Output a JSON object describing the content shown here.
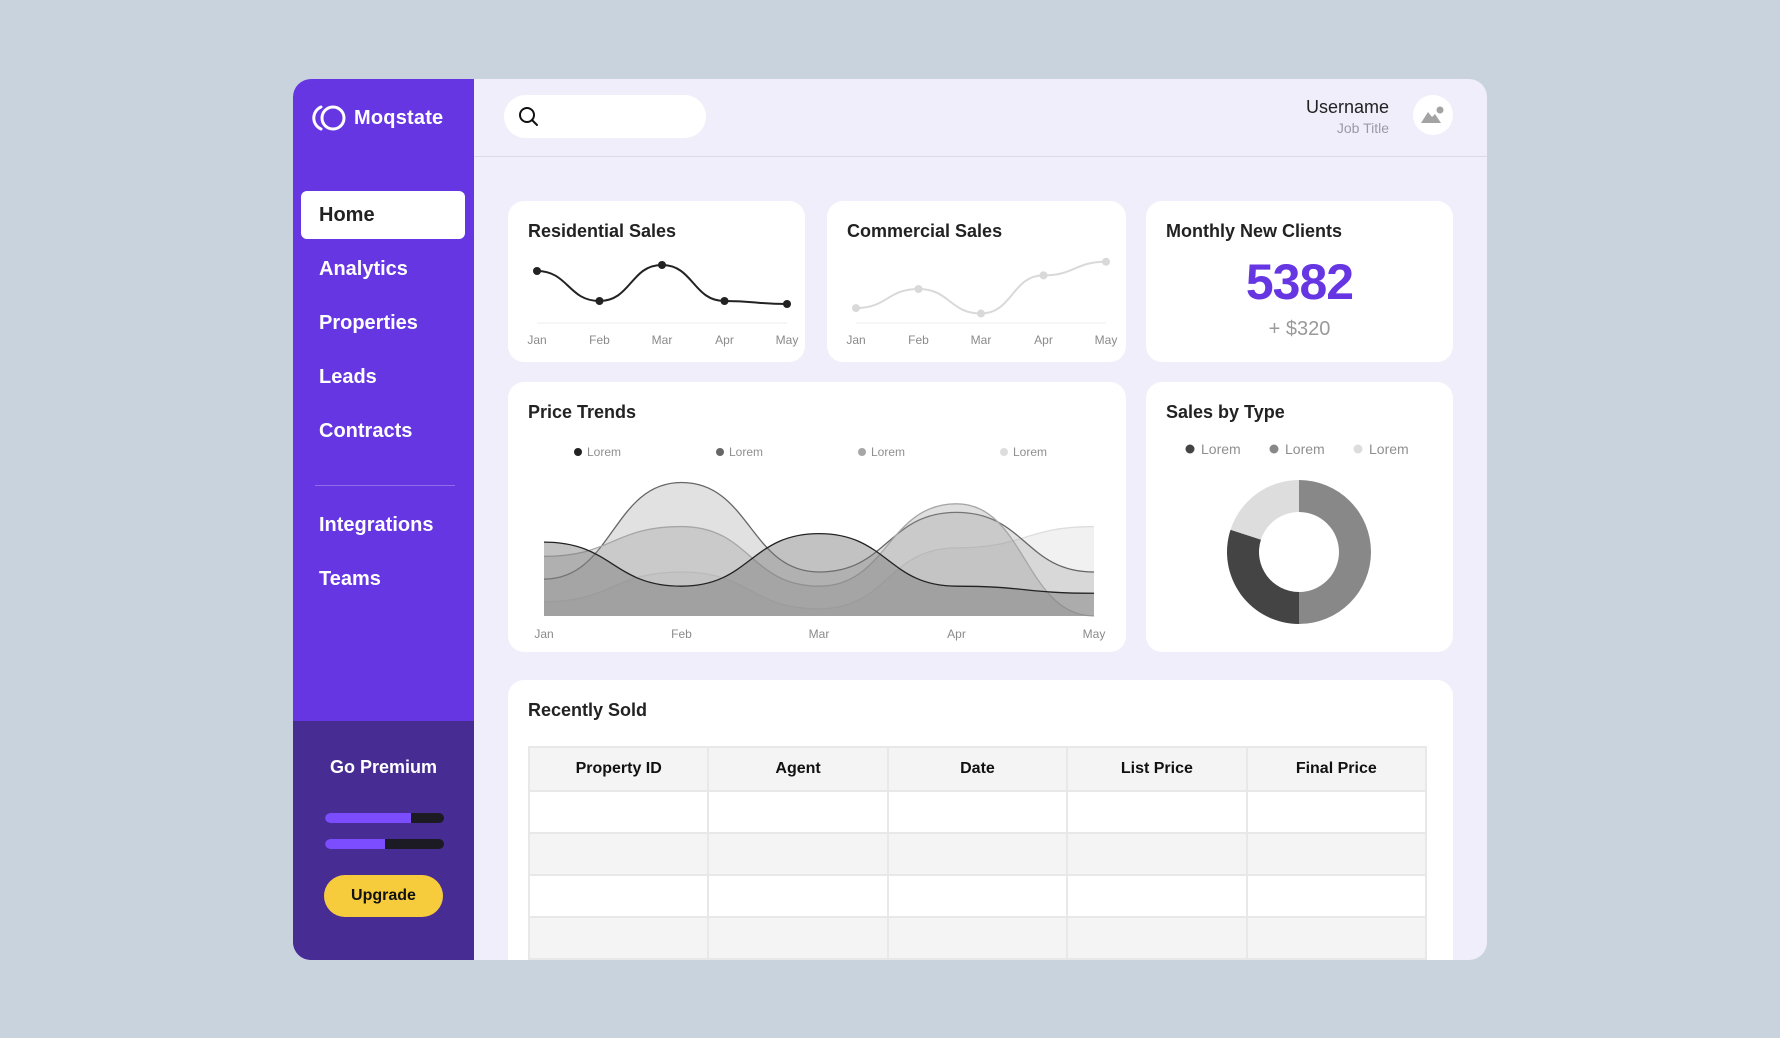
{
  "app": {
    "name": "Moqstate",
    "brand_color": "#6536e2",
    "sidebar_dark_color": "#472d93",
    "accent_yellow": "#f6cc3d"
  },
  "sidebar": {
    "primary_items": [
      {
        "label": "Home",
        "active": true
      },
      {
        "label": "Analytics",
        "active": false
      },
      {
        "label": "Properties",
        "active": false
      },
      {
        "label": "Leads",
        "active": false
      },
      {
        "label": "Contracts",
        "active": false
      }
    ],
    "secondary_items": [
      {
        "label": "Integrations",
        "active": false
      },
      {
        "label": "Teams",
        "active": false
      }
    ],
    "premium": {
      "title": "Go Premium",
      "progress": [
        0.72,
        0.5
      ],
      "button_label": "Upgrade"
    }
  },
  "header": {
    "search": {
      "value": "",
      "placeholder": "",
      "icon": "search-icon"
    },
    "user": {
      "name": "Username",
      "title": "Job Title",
      "avatar_icon": "image-placeholder-icon"
    }
  },
  "cards": {
    "residential": {
      "title": "Residential Sales"
    },
    "commercial": {
      "title": "Commercial Sales"
    },
    "clients": {
      "title": "Monthly New Clients",
      "value": "5382",
      "delta": "+ $320"
    },
    "price_trends": {
      "title": "Price Trends"
    },
    "sales_by_type": {
      "title": "Sales by Type"
    },
    "recently_sold": {
      "title": "Recently Sold",
      "columns": [
        "Property ID",
        "Agent",
        "Date",
        "List Price",
        "Final Price"
      ],
      "rows": [
        [
          "",
          "",
          "",
          "",
          ""
        ],
        [
          "",
          "",
          "",
          "",
          ""
        ],
        [
          "",
          "",
          "",
          "",
          ""
        ],
        [
          "",
          "",
          "",
          "",
          ""
        ]
      ]
    }
  },
  "chart_data": [
    {
      "id": "residential",
      "type": "line",
      "title": "Residential Sales",
      "categories": [
        "Jan",
        "Feb",
        "Mar",
        "Apr",
        "May"
      ],
      "values": [
        80,
        30,
        90,
        30,
        25
      ],
      "ylim": [
        0,
        100
      ],
      "color": "#222222",
      "markers": true
    },
    {
      "id": "commercial",
      "type": "line",
      "title": "Commercial Sales",
      "categories": [
        "Jan",
        "Feb",
        "Mar",
        "Apr",
        "May"
      ],
      "values": [
        20,
        55,
        10,
        80,
        105
      ],
      "ylim": [
        0,
        110
      ],
      "color": "#d9d9d9",
      "markers": true
    },
    {
      "id": "price_trends",
      "type": "area",
      "title": "Price Trends",
      "categories": [
        "Jan",
        "Feb",
        "Mar",
        "Apr",
        "May"
      ],
      "ylim": [
        0,
        100
      ],
      "legend_position": "top",
      "series": [
        {
          "name": "Lorem",
          "values": [
            52,
            21,
            58,
            21,
            16
          ],
          "color": "#222222"
        },
        {
          "name": "Lorem",
          "values": [
            26,
            94,
            31,
            73,
            31
          ],
          "color": "#666666"
        },
        {
          "name": "Lorem",
          "values": [
            42,
            63,
            21,
            79,
            0
          ],
          "color": "#a6a6a6"
        },
        {
          "name": "Lorem",
          "values": [
            10,
            31,
            5,
            48,
            63
          ],
          "color": "#dddddd"
        }
      ]
    },
    {
      "id": "sales_by_type",
      "type": "pie",
      "donut": true,
      "title": "Sales by Type",
      "legend_position": "top",
      "slices": [
        {
          "name": "Lorem",
          "value": 30,
          "color": "#444444"
        },
        {
          "name": "Lorem",
          "value": 50,
          "color": "#888888"
        },
        {
          "name": "Lorem",
          "value": 20,
          "color": "#dddddd"
        }
      ]
    }
  ]
}
